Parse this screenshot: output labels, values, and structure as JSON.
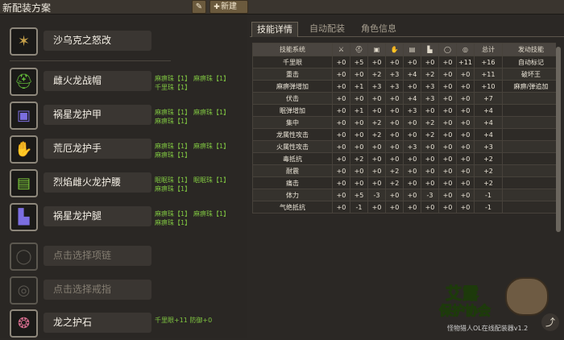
{
  "window": {
    "title": "新配装方案",
    "edit_icon": "pencil-icon",
    "new_label": "新建",
    "new_icon": "plus-icon"
  },
  "equipment": [
    {
      "name": "沙乌克之怒改",
      "icon": "weapon-icon",
      "icon_color": "#c8a24a",
      "decorations": []
    },
    {
      "name": "雌火龙战帽",
      "icon": "helmet-icon",
      "icon_color": "#66c23a",
      "decorations": [
        "麻痹珠【1】",
        "麻痹珠【1】",
        "千里珠【1】"
      ]
    },
    {
      "name": "祸星龙护甲",
      "icon": "chest-icon",
      "icon_color": "#7b6ee0",
      "decorations": [
        "麻痹珠【1】",
        "麻痹珠【1】",
        "麻痹珠【1】"
      ]
    },
    {
      "name": "荒厄龙护手",
      "icon": "arm-icon",
      "icon_color": "#a58fd8",
      "decorations": [
        "麻痹珠【1】",
        "麻痹珠【1】",
        "麻痹珠【1】"
      ]
    },
    {
      "name": "烈焰雌火龙护腰",
      "icon": "waist-icon",
      "icon_color": "#7fce3b",
      "decorations": [
        "眠眠珠【1】",
        "眠眠珠【1】",
        "麻痹珠【1】"
      ]
    },
    {
      "name": "祸星龙护腿",
      "icon": "leg-icon",
      "icon_color": "#7b6ee0",
      "decorations": [
        "麻痹珠【1】",
        "麻痹珠【1】",
        "麻痹珠【1】"
      ]
    },
    {
      "name": "点击选择项链",
      "icon": "necklace-icon",
      "icon_color": "#5a5750",
      "decorations": [],
      "empty": true
    },
    {
      "name": "点击选择戒指",
      "icon": "ring-icon",
      "icon_color": "#5a5750",
      "decorations": [],
      "empty": true
    },
    {
      "name": "龙之护石",
      "icon": "charm-icon",
      "icon_color": "#d06a8a",
      "decorations": [
        "千里眼+11 防御+0"
      ]
    }
  ],
  "tabs": [
    {
      "label": "技能详情",
      "active": true
    },
    {
      "label": "自动配装",
      "active": false
    },
    {
      "label": "角色信息",
      "active": false
    }
  ],
  "skills_table": {
    "header_name": "技能系统",
    "slot_icons": [
      "weapon-icon",
      "helmet-icon",
      "chest-icon",
      "arm-icon",
      "waist-icon",
      "leg-icon",
      "necklace-icon",
      "ring-icon"
    ],
    "header_total": "总计",
    "header_active": "发动技能",
    "rows": [
      {
        "name": "千里眼",
        "v": [
          "+0",
          "+5",
          "+0",
          "+0",
          "+0",
          "+0",
          "+0",
          "+11"
        ],
        "total": "+16",
        "active": "自动标记"
      },
      {
        "name": "重击",
        "v": [
          "+0",
          "+0",
          "+2",
          "+3",
          "+4",
          "+2",
          "+0",
          "+0"
        ],
        "total": "+11",
        "active": "破坏王"
      },
      {
        "name": "麻痹弹增加",
        "v": [
          "+0",
          "+1",
          "+3",
          "+3",
          "+0",
          "+3",
          "+0",
          "+0"
        ],
        "total": "+10",
        "active": "麻痹/弹追加"
      },
      {
        "name": "伏击",
        "v": [
          "+0",
          "+0",
          "+0",
          "+0",
          "+4",
          "+3",
          "+0",
          "+0"
        ],
        "total": "+7",
        "active": ""
      },
      {
        "name": "眠弹增加",
        "v": [
          "+0",
          "+1",
          "+0",
          "+0",
          "+3",
          "+0",
          "+0",
          "+0"
        ],
        "total": "+4",
        "active": ""
      },
      {
        "name": "集中",
        "v": [
          "+0",
          "+0",
          "+2",
          "+0",
          "+0",
          "+2",
          "+0",
          "+0"
        ],
        "total": "+4",
        "active": ""
      },
      {
        "name": "龙属性攻击",
        "v": [
          "+0",
          "+0",
          "+2",
          "+0",
          "+0",
          "+2",
          "+0",
          "+0"
        ],
        "total": "+4",
        "active": ""
      },
      {
        "name": "火属性攻击",
        "v": [
          "+0",
          "+0",
          "+0",
          "+0",
          "+3",
          "+0",
          "+0",
          "+0"
        ],
        "total": "+3",
        "active": ""
      },
      {
        "name": "毒抵抗",
        "v": [
          "+0",
          "+2",
          "+0",
          "+0",
          "+0",
          "+0",
          "+0",
          "+0"
        ],
        "total": "+2",
        "active": ""
      },
      {
        "name": "耐震",
        "v": [
          "+0",
          "+0",
          "+0",
          "+2",
          "+0",
          "+0",
          "+0",
          "+0"
        ],
        "total": "+2",
        "active": ""
      },
      {
        "name": "痛击",
        "v": [
          "+0",
          "+0",
          "+0",
          "+2",
          "+0",
          "+0",
          "+0",
          "+0"
        ],
        "total": "+2",
        "active": ""
      },
      {
        "name": "体力",
        "v": [
          "+0",
          "+5",
          "-3",
          "+0",
          "+0",
          "-3",
          "+0",
          "+0"
        ],
        "total": "-1",
        "active": ""
      },
      {
        "name": "气绝抵抗",
        "v": [
          "+0",
          "-1",
          "+0",
          "+0",
          "+0",
          "+0",
          "+0",
          "+0"
        ],
        "total": "-1",
        "active": ""
      }
    ]
  },
  "watermark": {
    "line1": "艾露",
    "line2": "保护协会",
    "line3": "怪物猎人OL在线配装器v1.2"
  },
  "share_icon": "share-icon"
}
